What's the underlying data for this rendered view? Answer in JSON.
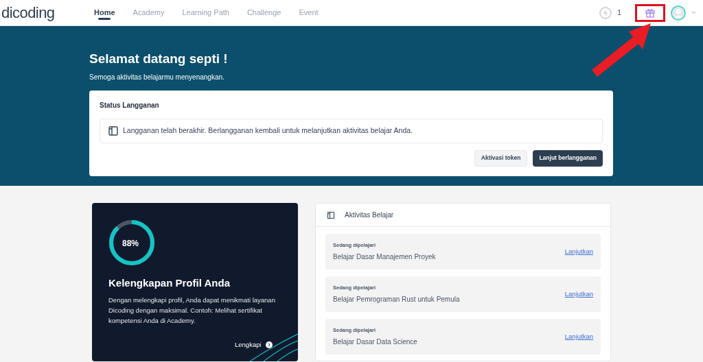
{
  "header": {
    "logo": "dicoding",
    "nav": [
      {
        "label": "Home",
        "selected": true
      },
      {
        "label": "Academy",
        "selected": false
      },
      {
        "label": "Learning Path",
        "selected": false
      },
      {
        "label": "Challenge",
        "selected": false
      },
      {
        "label": "Event",
        "selected": false
      }
    ],
    "points": "1"
  },
  "callout": {
    "shown": true
  },
  "hero": {
    "title": "Selamat datang septi !",
    "subtitle": "Semoga aktivitas belajarmu menyenangkan."
  },
  "subscription": {
    "title": "Status Langganan",
    "message": "Langganan telah berakhir. Berlangganan kembali untuk melanjutkan aktivitas belajar Anda.",
    "buttons": [
      {
        "label": "Aktivasi token",
        "kind": "secondary"
      },
      {
        "label": "Lanjut berlangganan",
        "kind": "primary"
      }
    ]
  },
  "profile": {
    "level": 0.88,
    "percent": "88%",
    "title": "Kelengkapan Profil Anda",
    "text": "Dengan melengkapi profil, Anda dapat menikmati layanan Dicoding dengan maksimal. Contoh: Melihat sertifikat kompetensi Anda di Academy.",
    "link": "Lengkapi"
  },
  "activity": {
    "title": "Aktivitas Belajar",
    "items": [
      {
        "status": "Sedang dipelajari",
        "course": "Belajar Dasar Manajemen Proyek",
        "action": "Lanjutkan"
      },
      {
        "status": "Sedang dipelajari",
        "course": "Belajar Pemrograman Rust untuk Pemula",
        "action": "Lanjutkan"
      },
      {
        "status": "Sedang dipelajari",
        "course": "Belajar Dasar Data Science",
        "action": "Lanjutkan"
      }
    ]
  }
}
